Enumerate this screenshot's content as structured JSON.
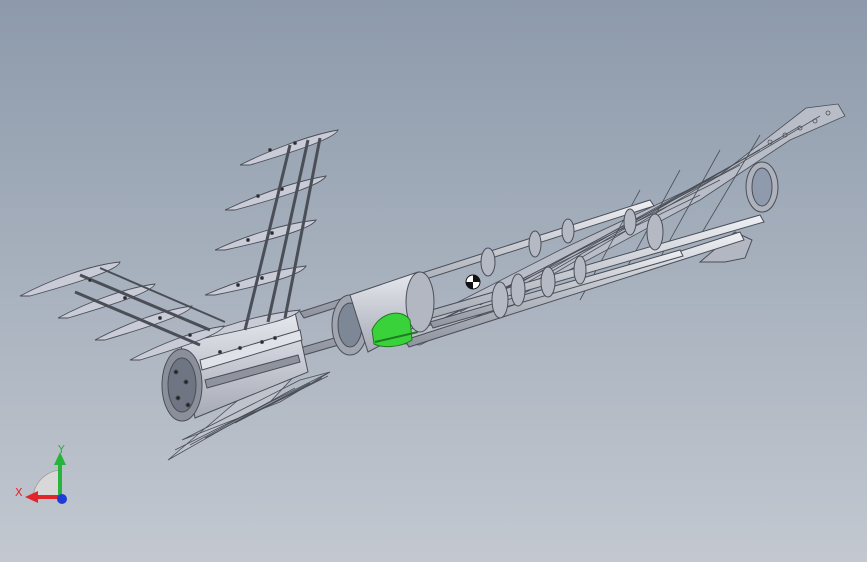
{
  "window": {
    "title": ""
  },
  "viewport": {
    "background_top": "#8d9aab",
    "background_bottom": "#c3c8d0",
    "model": {
      "name": "",
      "frame_color": "#4a4e57",
      "surface_color": "#c9ccd6",
      "highlight_color": "#39d23a"
    },
    "triad": {
      "x_label": "X",
      "y_label": "Y",
      "x_color": "#e0262b",
      "y_color": "#27b43a",
      "z_color": "#1f3dd6"
    }
  }
}
